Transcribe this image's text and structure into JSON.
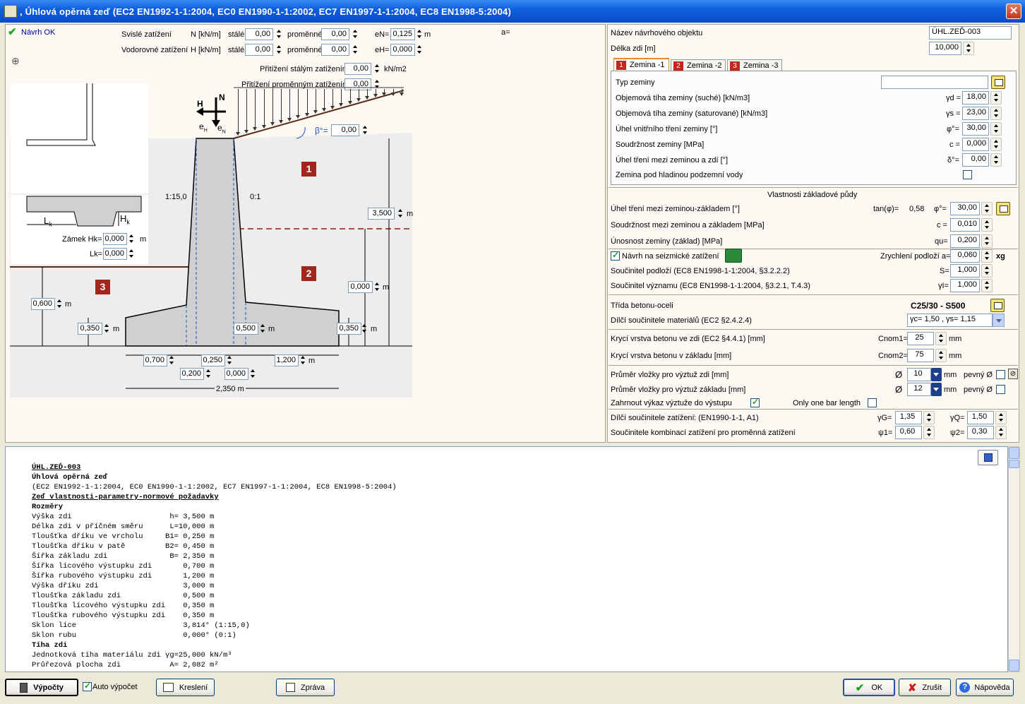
{
  "window": {
    "title": ", Úhlová opěrná zeď (EC2 EN1992-1-1:2004, EC0 EN1990-1-1:2002, EC7 EN1997-1-1:2004, EC8 EN1998-5:2004)",
    "close": "✕"
  },
  "status": {
    "ok_label": "Návrh OK"
  },
  "loads": {
    "vertical_label": "Svislé zatížení",
    "vertical_unit": "N [kN/m]",
    "horizontal_label": "Vodorovné zatížení",
    "horizontal_unit": "H [kN/m]",
    "stale": "stálé",
    "promenne": "proměnné",
    "n_stale": "0,00",
    "n_prom": "0,00",
    "h_stale": "0,00",
    "h_prom": "0,00",
    "en_label": "eN=",
    "en": "0,125",
    "en_unit": "m",
    "eh_label": "eH=",
    "eh": "0,000",
    "a_label": "a=",
    "surcharge_perm_label": "Přitížení stálým zatížením",
    "surcharge_perm": "0,00",
    "surcharge_unit": "kN/m2",
    "surcharge_var_label": "Přitížení proměnným zatížením",
    "surcharge_var": "0,00"
  },
  "diagram": {
    "beta_label": "β°=",
    "beta": "0,00",
    "H": "H",
    "N": "N",
    "eH": "e",
    "eN": "e",
    "sub_h": "H",
    "sub_n": "N",
    "zone1": "1",
    "zone2": "2",
    "zone3": "3",
    "slope_front": "1:15,0",
    "slope_back": "0:1",
    "height": "3,500",
    "water": "0,000",
    "ground_front": "0,600",
    "t_toe": "0,350",
    "t_base": "0,500",
    "t_heel": "0,350",
    "toe": "0,700",
    "stem_top": "0,250",
    "heel": "1,200",
    "stem_bottom": "0,200",
    "back_off": "0,000",
    "total": "2,350",
    "unit": "m",
    "key_label": "Zámek Hk=",
    "key_hk": "0,000",
    "key_lk_label": "Lk=",
    "key_lk": "0,000",
    "lk": "L",
    "lk_sub": "k",
    "hk": "H",
    "hk_sub": "k"
  },
  "object": {
    "name_label": "Název návrhového objektu",
    "name": "ÚHL.ZEĎ-003",
    "length_label": "Délka zdi [m]",
    "length": "10,000"
  },
  "soil_tabs": [
    {
      "n": "1",
      "label": "Zemina -1"
    },
    {
      "n": "2",
      "label": "Zemina -2"
    },
    {
      "n": "3",
      "label": "Zemina -3"
    }
  ],
  "soil": {
    "type_label": "Typ zeminy",
    "type": "",
    "rows": [
      {
        "label": "Objemová tíha zeminy (suché) [kN/m3]",
        "sym": "γd =",
        "val": "18,00"
      },
      {
        "label": "Objemová tíha zeminy (saturované) [kN/m3]",
        "sym": "γs =",
        "val": "23,00"
      },
      {
        "label": "Úhel vnitřního tření zeminy [°]",
        "sym": "φ°=",
        "val": "30,00"
      },
      {
        "label": "Soudržnost zeminy [MPa]",
        "sym": "c =",
        "val": "0,000"
      },
      {
        "label": "Úhel tření mezi zeminou a zdí [°]",
        "sym": "δ°=",
        "val": "0,00"
      }
    ],
    "underwater_label": "Zemina pod hladinou podzemní vody"
  },
  "foundation": {
    "header": "Vlastnosti základové půdy",
    "friction_label": "Úhel tření mezi zeminou-základem [°]",
    "tan_label": "tan(φ)=",
    "tan": "0,58",
    "phi_sym": "φ°=",
    "phi": "30,00",
    "cohesion_label": "Soudržnost mezi zeminou a základem [MPa]",
    "c_sym": "c =",
    "c": "0,010",
    "bearing_label": "Únosnost zeminy (základ) [MPa]",
    "qu_sym": "qu=",
    "qu": "0,200"
  },
  "seismic": {
    "label": "Návrh na seizmické zatížení",
    "accel_label": "Zrychlení podloží a=",
    "accel": "0,060",
    "accel_unit": "xg",
    "soil_factor_label": "Součinitel podloží (EC8 EN1998-1-1:2004, §3.2.2.2)",
    "s_sym": "S=",
    "s": "1,000",
    "importance_label": "Součinitel významu (EC8 EN1998-1-1:2004, §3.2.1, T.4.3)",
    "gi_sym": "γI=",
    "gi": "1,000"
  },
  "concrete": {
    "class_label": "Třída betonu-oceli",
    "class": "C25/30 - S500",
    "partial_label": "Dílčí součinitele materiálů (EC2 §2.4.2.4)",
    "partial": "γc= 1,50 , γs= 1,15",
    "cover_wall_label": "Krycí vrstva betonu ve zdi (EC2 §4.4.1) [mm]",
    "cnom1_label": "Cnom1=",
    "cnom1": "25",
    "mm": "mm",
    "cover_base_label": "Krycí vrstva betonu v základu  [mm]",
    "cnom2_label": "Cnom2=",
    "cnom2": "75"
  },
  "rebar": {
    "wall_label": "Průměr vložky pro výztuž zdi [mm]",
    "wall": "10",
    "base_label": "Průměr vložky pro výztuž základu [mm]",
    "base": "12",
    "dia": "Ø",
    "mm": "mm",
    "fixed": "pevný Ø",
    "include_label": "Zahrnout výkaz výztuže do výstupu",
    "one_bar_label": "Only one bar length"
  },
  "factors": {
    "load_label": "Dílčí součinitele zatížení",
    "load_std": ": (EN1990-1-1, A1)",
    "gg_sym": "γG=",
    "gg": "1,35",
    "gq_sym": "γQ=",
    "gq": "1,50",
    "comb_label": "Součinitele kombinací zatížení pro proměnná zatížení",
    "psi1_sym": "ψ1=",
    "psi1": "0,60",
    "psi2_sym": "ψ2=",
    "psi2": "0,30"
  },
  "report_lines": [
    {
      "t": "ÚHL.ZEĎ-003",
      "b": true,
      "u": true
    },
    {
      "t": "Úhlová opěrná zeď",
      "b": true
    },
    {
      "t": "(EC2 EN1992-1-1:2004, EC0 EN1990-1-1:2002, EC7 EN1997-1-1:2004, EC8 EN1998-5:2004)"
    },
    {
      "t": "Zeď vlastnosti-parametry-normové požadavky",
      "b": true,
      "u": true
    },
    {
      "t": "Rozměry",
      "b": true
    },
    {
      "t": "Výška zdi                      h= 3,500 m"
    },
    {
      "t": "Délka zdi v příčném směru      L=10,000 m"
    },
    {
      "t": "Tloušťka dříku ve vrcholu     B1= 0,250 m"
    },
    {
      "t": "Tloušťka dříku v patě         B2= 0,450 m"
    },
    {
      "t": "Šířka základu zdi              B= 2,350 m"
    },
    {
      "t": "Šířka lícového výstupku zdi       0,700 m"
    },
    {
      "t": "Šířka rubového výstupku zdi       1,200 m"
    },
    {
      "t": "Výška dříku zdi                   3,000 m"
    },
    {
      "t": "Tloušťka základu zdi              0,500 m"
    },
    {
      "t": "Tloušťka lícového výstupku zdi    0,350 m"
    },
    {
      "t": "Tloušťka rubového výstupku zdi    0,350 m"
    },
    {
      "t": "Sklon líce                        3,814° (1:15,0)"
    },
    {
      "t": "Sklon rubu                        0,000° (0:1)"
    },
    {
      "t": "Tíha zdi",
      "b": true
    },
    {
      "t": "Jednotková tíha materiálu zdi γg=25,000 kN/m³"
    },
    {
      "t": "Průřezová plocha zdi           A= 2,082 m²"
    }
  ],
  "bottom": {
    "calc": "Výpočty",
    "auto": "Auto výpočet",
    "draw": "Kreslení",
    "report": "Zpráva",
    "ok": "OK",
    "cancel": "Zrušit",
    "help": "Nápověda"
  }
}
